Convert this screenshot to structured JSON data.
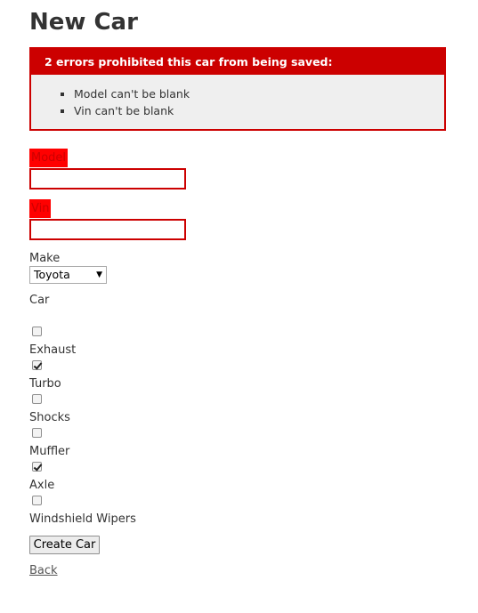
{
  "page_title": "New Car",
  "errors": {
    "header": "2 errors prohibited this car from being saved:",
    "items": [
      "Model can't be blank",
      "Vin can't be blank"
    ]
  },
  "form": {
    "model_label": "Model",
    "model_value": "",
    "vin_label": "Vin",
    "vin_value": "",
    "make_label": "Make",
    "make_selected": "Toyota",
    "car_label": "Car",
    "options": [
      {
        "label": "Exhaust",
        "checked": false
      },
      {
        "label": "Turbo",
        "checked": true
      },
      {
        "label": "Shocks",
        "checked": false
      },
      {
        "label": "Muffler",
        "checked": false
      },
      {
        "label": "Axle",
        "checked": true
      },
      {
        "label": "Windshield Wipers",
        "checked": false
      }
    ],
    "submit_label": "Create Car"
  },
  "back_link": "Back",
  "colors": {
    "error": "#cc0000",
    "error_bg": "#efefef"
  }
}
